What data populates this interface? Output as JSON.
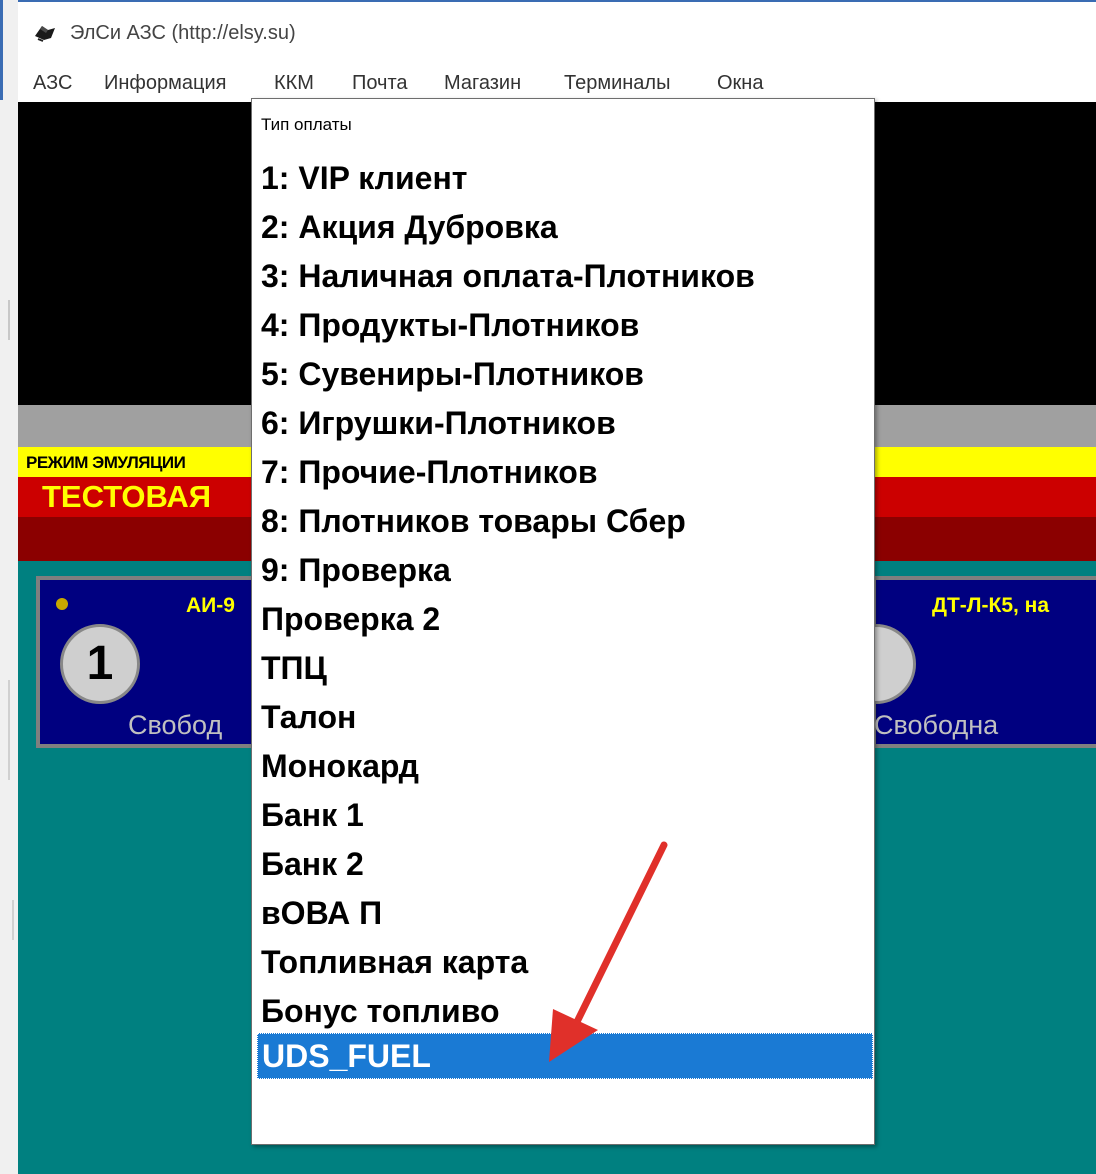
{
  "window": {
    "title": "ЭлСи АЗС  (http://elsy.su)",
    "icon": "app-logo-icon"
  },
  "menu": [
    "АЗС",
    "Информация",
    "ККМ",
    "Почта",
    "Магазин",
    "Терминалы",
    "Окна"
  ],
  "banner": {
    "mode": "РЕЖИМ ЭМУЛЯЦИИ",
    "test": "ТЕСТОВАЯ"
  },
  "pumps": [
    {
      "number": "1",
      "fuel": "АИ-9",
      "status": "Свобод"
    },
    {
      "number": "",
      "fuel": "ДТ-Л-К5, на",
      "status": "Свободна"
    }
  ],
  "payment_popup": {
    "header": "Тип оплаты",
    "options": [
      "1: VIP клиент",
      "2: Акция Дубровка",
      "3: Наличная оплата-Плотников",
      "4: Продукты-Плотников",
      "5: Сувениры-Плотников",
      "6: Игрушки-Плотников",
      "7: Прочие-Плотников",
      "8: Плотников товары Сбер",
      "9: Проверка",
      "Проверка 2",
      "ТПЦ",
      "Талон",
      "Монокард",
      "Банк 1",
      "Банк 2",
      "вОВА П",
      "Топливная карта",
      "Бонус топливо",
      "UDS_FUEL"
    ],
    "selected": "UDS_FUEL"
  },
  "colors": {
    "selection": "#1a7ad4",
    "annotation_arrow": "#e0302a",
    "teal": "#008080",
    "pump_panel": "#000080",
    "banner_yellow": "#ffff00",
    "banner_red": "#cc0000"
  }
}
